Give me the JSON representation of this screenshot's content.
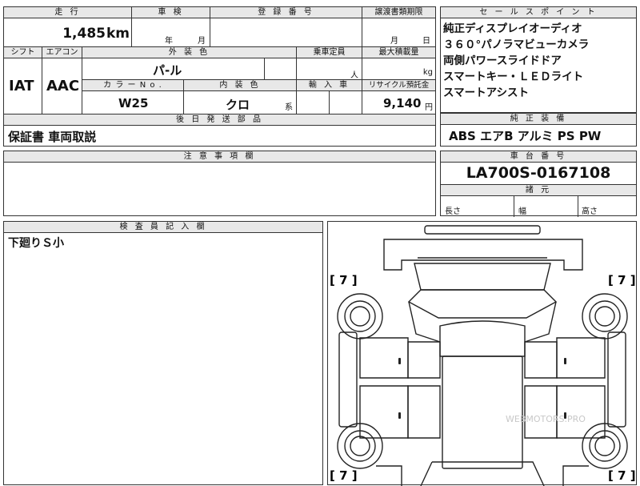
{
  "main_table": {
    "mileage_label": "走 行",
    "mileage_value": "1,485",
    "mileage_unit": "km",
    "inspection_label": "車 検",
    "inspection_year": "年",
    "inspection_month": "月",
    "registration_label": "登 録 番 号",
    "transfer_label": "譲渡書類期限",
    "transfer_month": "月",
    "transfer_day": "日",
    "shift_label": "シフト",
    "ac_label": "エアコン",
    "exterior_label": "外 装 色",
    "exterior_value": "パ-ル",
    "capacity_label": "乗車定員",
    "capacity_unit": "人",
    "max_load_label": "最大積載量",
    "max_load_unit": "kg",
    "shift_value": "IAT",
    "ac_value": "AAC",
    "color_no_label": "カ ラ ー N o .",
    "color_no_value": "W25",
    "interior_label": "内 装 色",
    "interior_value": "クロ",
    "interior_suffix": "系",
    "import_label": "輸 入 車",
    "recycle_label": "リサイクル預託金",
    "recycle_value": "9,140",
    "recycle_unit": "円",
    "later_parts_label": "後 日 発 送 部 品",
    "later_parts_value": "保証書 車両取説"
  },
  "sales_points": {
    "header": "セ ー ル ス ポ イ ン ト",
    "lines": [
      "純正ディスプレイオーディオ",
      "３６０°パノラマビューカメラ",
      "両側パワースライドドア",
      "スマートキー・ＬＥＤライト",
      "スマートアシスト"
    ]
  },
  "factory_equipment": {
    "header": "純 正 装 備",
    "value": "ABS エアB アルミ PS PW"
  },
  "notes": {
    "header": "注 意 事 項 欄",
    "value": ""
  },
  "chassis": {
    "header": "車 台 番 号",
    "value": "LA700S-0167108",
    "dims_header": "諸 元",
    "length_label": "長さ",
    "width_label": "幅",
    "height_label": "高さ"
  },
  "inspector": {
    "header": "検 査 員 記 入 欄",
    "value": "下廻りＳ小"
  },
  "diagram": {
    "tire_markers": [
      "[ 7 ]",
      "[ 7 ]",
      "[ 7 ]",
      "[ 7 ]"
    ],
    "watermark": "WEBMOTORS.PRO"
  }
}
